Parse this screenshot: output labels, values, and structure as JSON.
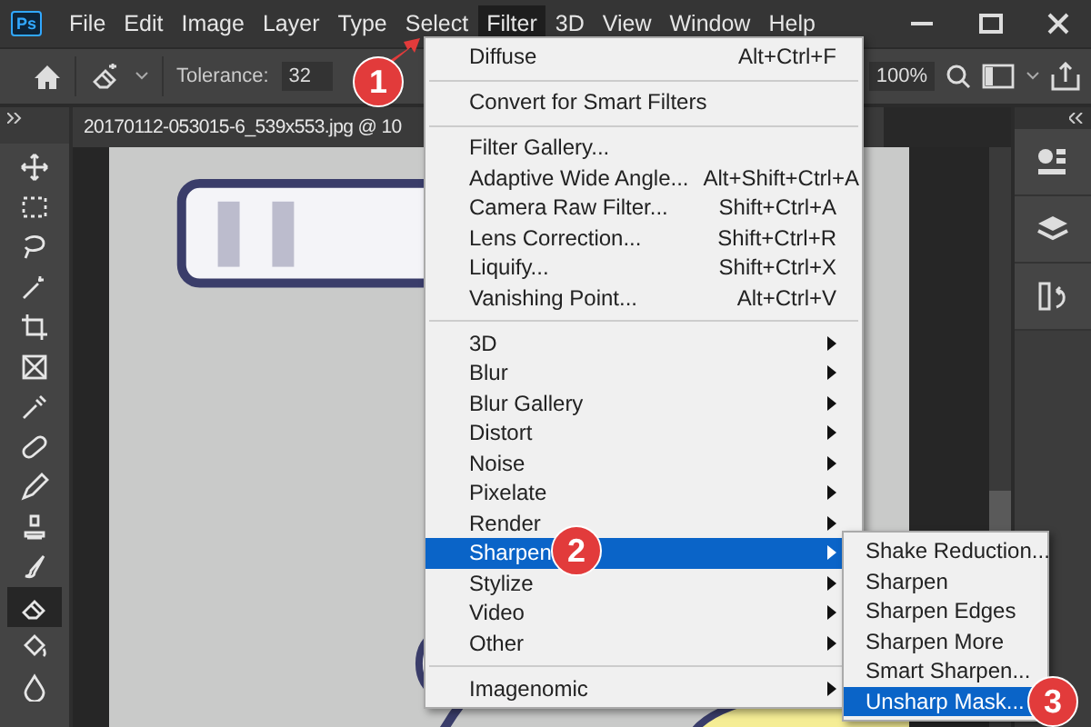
{
  "logo": "Ps",
  "menu_bar": [
    {
      "label": "File",
      "selected": false
    },
    {
      "label": "Edit",
      "selected": false
    },
    {
      "label": "Image",
      "selected": false
    },
    {
      "label": "Layer",
      "selected": false
    },
    {
      "label": "Type",
      "selected": false
    },
    {
      "label": "Select",
      "selected": false
    },
    {
      "label": "Filter",
      "selected": true
    },
    {
      "label": "3D",
      "selected": false
    },
    {
      "label": "View",
      "selected": false
    },
    {
      "label": "Window",
      "selected": false
    },
    {
      "label": "Help",
      "selected": false
    }
  ],
  "options_bar": {
    "tolerance_label": "Tolerance:",
    "tolerance_value": "32",
    "zoom_value": "100%"
  },
  "document_tab": {
    "title": "20170112-053015-6_539x553.jpg @ 10"
  },
  "tools": [
    {
      "selected": false
    },
    {
      "selected": false
    },
    {
      "selected": false
    },
    {
      "selected": false
    },
    {
      "selected": false
    },
    {
      "selected": false
    },
    {
      "selected": false
    },
    {
      "selected": false
    },
    {
      "selected": false
    },
    {
      "selected": false
    },
    {
      "selected": false
    },
    {
      "selected": true
    },
    {
      "selected": false
    },
    {
      "selected": false
    }
  ],
  "filter_menu": {
    "groups": [
      [
        {
          "label": "Diffuse",
          "shortcut": "Alt+Ctrl+F",
          "submenu": false,
          "selected": false
        }
      ],
      [
        {
          "label": "Convert for Smart Filters",
          "submenu": false,
          "selected": false
        }
      ],
      [
        {
          "label": "Filter Gallery...",
          "submenu": false,
          "selected": false
        },
        {
          "label": "Adaptive Wide Angle...",
          "shortcut": "Alt+Shift+Ctrl+A",
          "submenu": false,
          "selected": false
        },
        {
          "label": "Camera Raw Filter...",
          "shortcut": "Shift+Ctrl+A",
          "submenu": false,
          "selected": false
        },
        {
          "label": "Lens Correction...",
          "shortcut": "Shift+Ctrl+R",
          "submenu": false,
          "selected": false
        },
        {
          "label": "Liquify...",
          "shortcut": "Shift+Ctrl+X",
          "submenu": false,
          "selected": false
        },
        {
          "label": "Vanishing Point...",
          "shortcut": "Alt+Ctrl+V",
          "submenu": false,
          "selected": false
        }
      ],
      [
        {
          "label": "3D",
          "submenu": true,
          "selected": false
        },
        {
          "label": "Blur",
          "submenu": true,
          "selected": false
        },
        {
          "label": "Blur Gallery",
          "submenu": true,
          "selected": false
        },
        {
          "label": "Distort",
          "submenu": true,
          "selected": false
        },
        {
          "label": "Noise",
          "submenu": true,
          "selected": false
        },
        {
          "label": "Pixelate",
          "submenu": true,
          "selected": false
        },
        {
          "label": "Render",
          "submenu": true,
          "selected": false
        },
        {
          "label": "Sharpen",
          "submenu": true,
          "selected": true
        },
        {
          "label": "Stylize",
          "submenu": true,
          "selected": false
        },
        {
          "label": "Video",
          "submenu": true,
          "selected": false
        },
        {
          "label": "Other",
          "submenu": true,
          "selected": false
        }
      ],
      [
        {
          "label": "Imagenomic",
          "submenu": true,
          "selected": false
        }
      ]
    ]
  },
  "sharpen_submenu": {
    "items": [
      {
        "label": "Shake Reduction...",
        "selected": false
      },
      {
        "label": "Sharpen",
        "selected": false
      },
      {
        "label": "Sharpen Edges",
        "selected": false
      },
      {
        "label": "Sharpen More",
        "selected": false
      },
      {
        "label": "Smart Sharpen...",
        "selected": false
      },
      {
        "label": "Unsharp Mask...",
        "selected": true
      }
    ]
  },
  "step_markers": [
    "1",
    "2",
    "3"
  ]
}
